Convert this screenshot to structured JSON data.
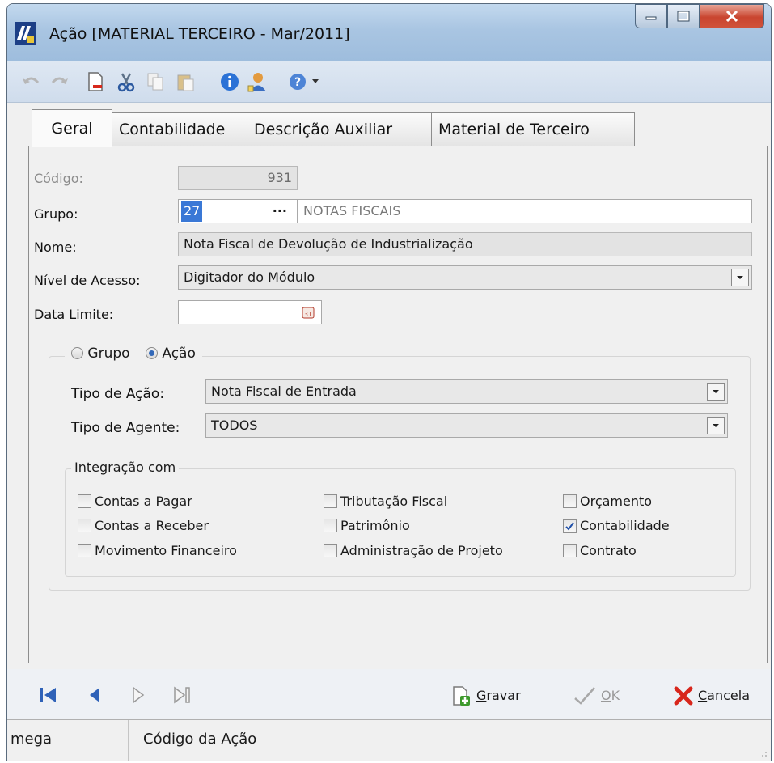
{
  "window": {
    "title": "Ação [MATERIAL TERCEIRO - Mar/2011]"
  },
  "toolbar": {
    "icons": [
      "undo-icon",
      "redo-icon",
      "new-document-icon",
      "cut-icon",
      "copy-icon",
      "paste-icon",
      "info-icon",
      "user-icon",
      "help-icon"
    ]
  },
  "tabs": [
    {
      "label": "Geral"
    },
    {
      "label": "Contabilidade"
    },
    {
      "label": "Descrição Auxiliar"
    },
    {
      "label": "Material de Terceiro"
    }
  ],
  "form": {
    "codigo_label": "Código:",
    "codigo_value": "931",
    "grupo_label": "Grupo:",
    "grupo_value": "27",
    "grupo_browse": "···",
    "grupo_desc": "NOTAS FISCAIS",
    "nome_label": "Nome:",
    "nome_value": "Nota Fiscal de Devolução de Industrialização",
    "nivel_label": "Nível de Acesso:",
    "nivel_value": "Digitador do Módulo",
    "data_limite_label": "Data Limite:",
    "data_limite_value": ""
  },
  "mode": {
    "grupo_label": "Grupo",
    "acao_label": "Ação",
    "selected": "Ação",
    "tipo_acao_label": "Tipo de Ação:",
    "tipo_acao_value": "Nota Fiscal de Entrada",
    "tipo_agente_label": "Tipo de Agente:",
    "tipo_agente_value": "TODOS"
  },
  "integracao": {
    "title": "Integração com",
    "items": [
      {
        "label": "Contas a Pagar",
        "checked": false
      },
      {
        "label": "Contas a Receber",
        "checked": false
      },
      {
        "label": "Movimento Financeiro",
        "checked": false
      },
      {
        "label": "Tributação Fiscal",
        "checked": false
      },
      {
        "label": "Patrimônio",
        "checked": false
      },
      {
        "label": "Administração de Projeto",
        "checked": false
      },
      {
        "label": "Orçamento",
        "checked": false
      },
      {
        "label": "Contabilidade",
        "checked": true
      },
      {
        "label": "Contrato",
        "checked": false
      }
    ]
  },
  "actions": {
    "gravar_mn": "G",
    "gravar_rest": "ravar",
    "ok_mn": "O",
    "ok_rest": "K",
    "cancela_mn": "C",
    "cancela_rest": "ancela"
  },
  "status": {
    "user": "mega",
    "hint": "Código da Ação"
  },
  "colors": {
    "nav_blue": "#2f62b8",
    "cancel_red": "#d8261b",
    "check_blue": "#1f4fa8"
  }
}
